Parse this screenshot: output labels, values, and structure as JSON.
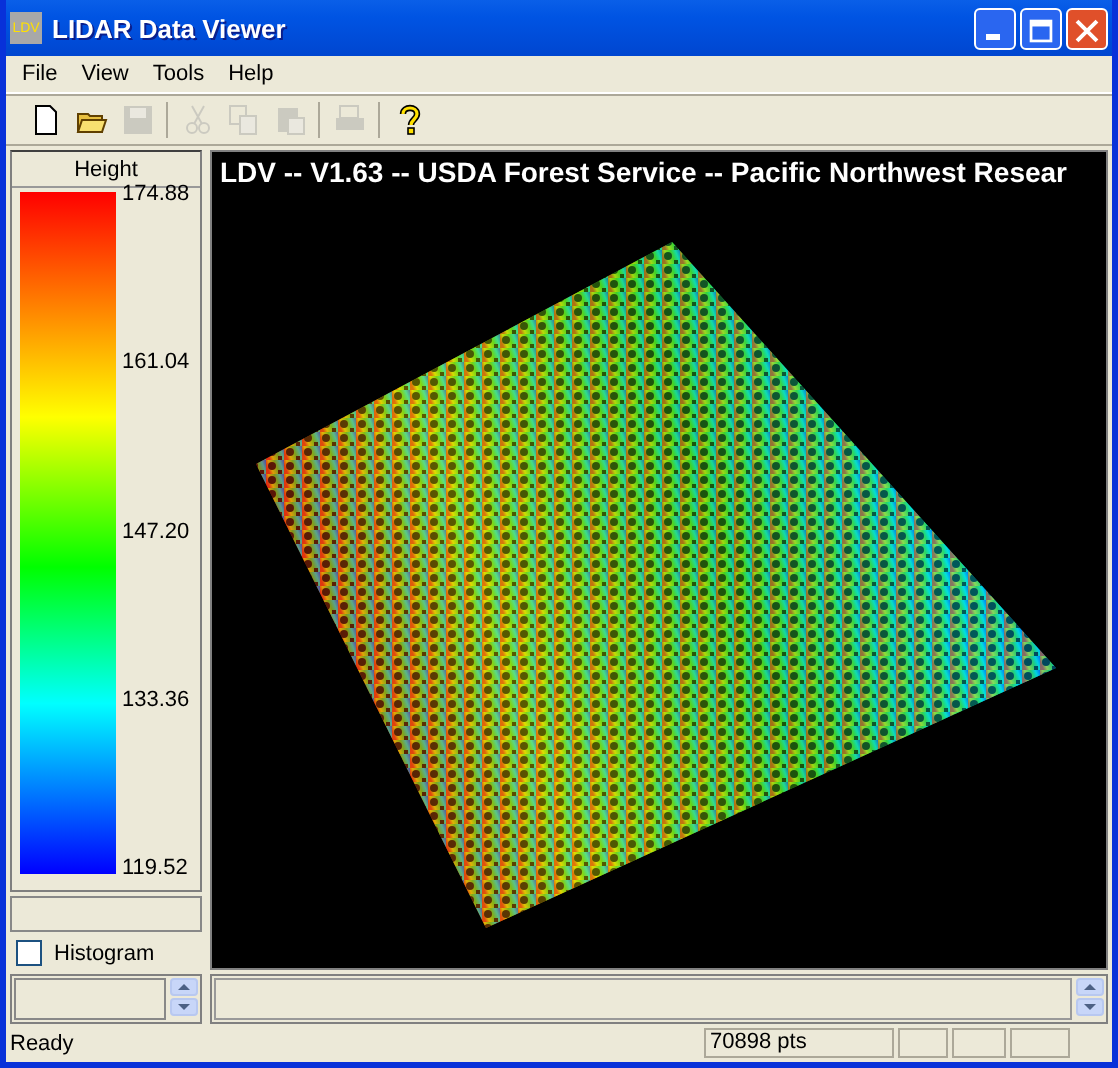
{
  "window": {
    "title": "LIDAR Data Viewer",
    "icon_text": "LDV"
  },
  "menu": [
    "File",
    "View",
    "Tools",
    "Help"
  ],
  "toolbar": [
    {
      "kind": "new",
      "disabled": false
    },
    {
      "kind": "open",
      "disabled": false
    },
    {
      "kind": "save",
      "disabled": true
    },
    {
      "kind": "sep"
    },
    {
      "kind": "cut",
      "disabled": true
    },
    {
      "kind": "copy",
      "disabled": true
    },
    {
      "kind": "paste",
      "disabled": true
    },
    {
      "kind": "sep"
    },
    {
      "kind": "print",
      "disabled": true
    },
    {
      "kind": "sep"
    },
    {
      "kind": "help",
      "disabled": false
    }
  ],
  "legend": {
    "title": "Height",
    "labels": [
      "174.88",
      "161.04",
      "147.20",
      "133.36",
      "119.52"
    ]
  },
  "histogram": {
    "label": "Histogram",
    "checked": false
  },
  "viewport": {
    "caption": "LDV -- V1.63 -- USDA Forest Service -- Pacific Northwest Resear"
  },
  "status_bar": {
    "message": "Ready",
    "points": "70898 pts"
  }
}
